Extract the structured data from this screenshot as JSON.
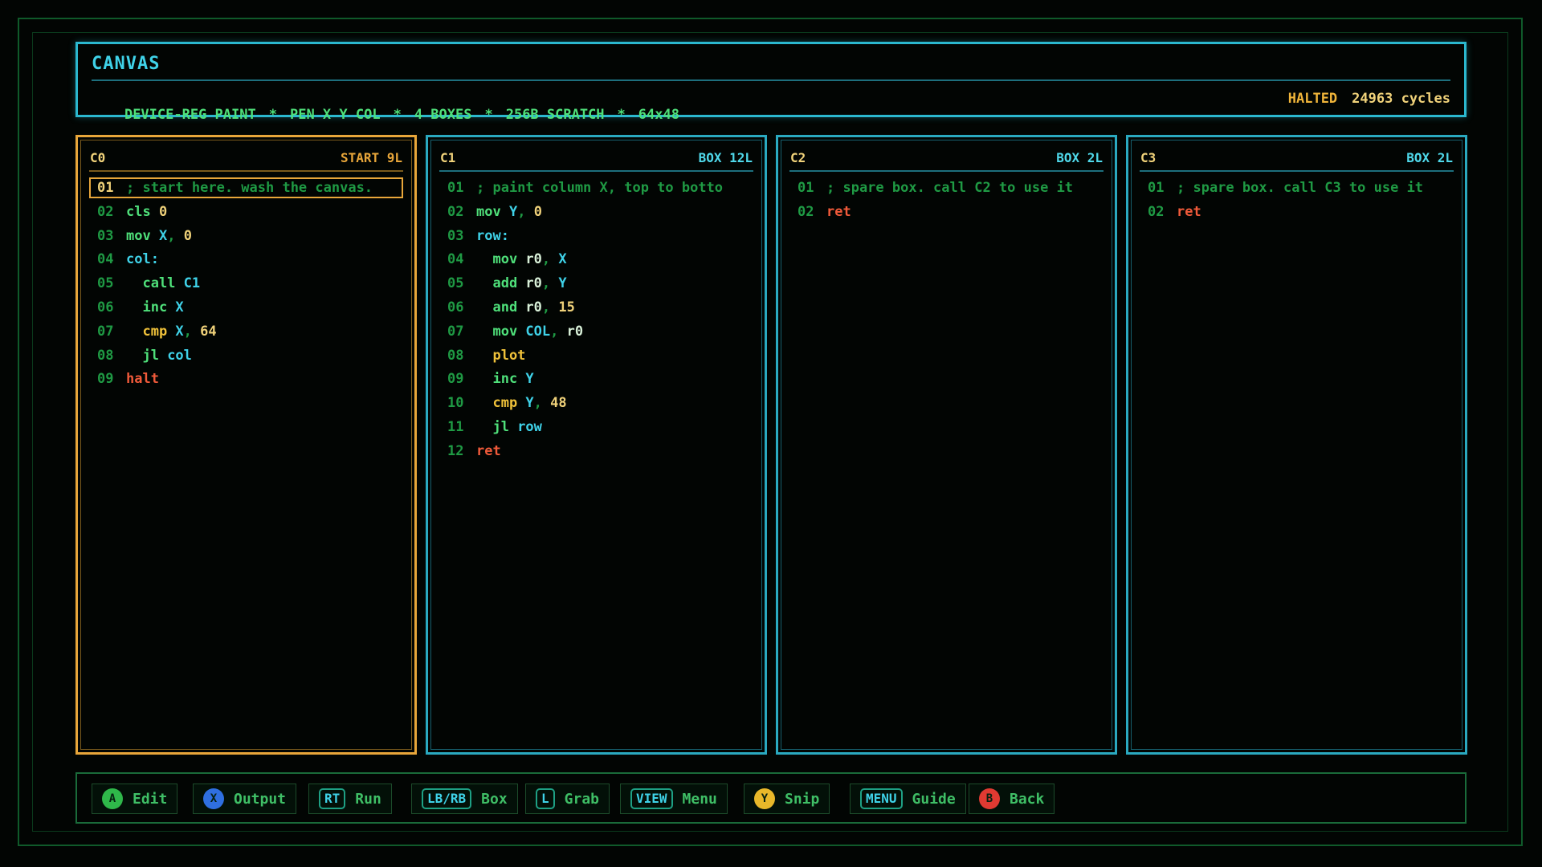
{
  "header": {
    "title": "CANVAS",
    "specs": [
      "DEVICE-REG PAINT",
      "PEN X Y COL",
      "4 BOXES",
      "256B SCRATCH",
      "64x48"
    ],
    "separator": "*",
    "status": "HALTED",
    "cycles": "24963 cycles"
  },
  "panels": [
    {
      "name": "C0",
      "meta": "START 9L",
      "lines": [
        {
          "n": "01",
          "parts": [
            {
              "t": "; start here. wash the canvas.",
              "c": "comment"
            }
          ]
        },
        {
          "n": "02",
          "parts": [
            {
              "t": "cls ",
              "c": "op-green"
            },
            {
              "t": "0",
              "c": "arg-yellow"
            }
          ]
        },
        {
          "n": "03",
          "parts": [
            {
              "t": "mov ",
              "c": "op-green"
            },
            {
              "t": "X",
              "c": "arg-cyan"
            },
            {
              "t": ", ",
              "c": "punct"
            },
            {
              "t": "0",
              "c": "arg-yellow"
            }
          ]
        },
        {
          "n": "04",
          "parts": [
            {
              "t": "col:",
              "c": "op-cyan"
            }
          ]
        },
        {
          "n": "05",
          "parts": [
            {
              "t": "  call ",
              "c": "op-green"
            },
            {
              "t": "C1",
              "c": "arg-cyan"
            }
          ]
        },
        {
          "n": "06",
          "parts": [
            {
              "t": "  inc ",
              "c": "op-green"
            },
            {
              "t": "X",
              "c": "arg-cyan"
            }
          ]
        },
        {
          "n": "07",
          "parts": [
            {
              "t": "  cmp ",
              "c": "op-yellow"
            },
            {
              "t": "X",
              "c": "arg-cyan"
            },
            {
              "t": ", ",
              "c": "punct"
            },
            {
              "t": "64",
              "c": "arg-yellow"
            }
          ]
        },
        {
          "n": "08",
          "parts": [
            {
              "t": "  jl ",
              "c": "op-green"
            },
            {
              "t": "col",
              "c": "arg-cyan"
            }
          ]
        },
        {
          "n": "09",
          "parts": [
            {
              "t": "halt",
              "c": "op-red"
            }
          ]
        }
      ]
    },
    {
      "name": "C1",
      "meta": "BOX 12L",
      "lines": [
        {
          "n": "01",
          "parts": [
            {
              "t": "; paint column X, top to botto",
              "c": "comment"
            }
          ]
        },
        {
          "n": "02",
          "parts": [
            {
              "t": "mov ",
              "c": "op-green"
            },
            {
              "t": "Y",
              "c": "arg-cyan"
            },
            {
              "t": ", ",
              "c": "punct"
            },
            {
              "t": "0",
              "c": "arg-yellow"
            }
          ]
        },
        {
          "n": "03",
          "parts": [
            {
              "t": "row:",
              "c": "op-cyan"
            }
          ]
        },
        {
          "n": "04",
          "parts": [
            {
              "t": "  mov ",
              "c": "op-green"
            },
            {
              "t": "r0",
              "c": "arg-white"
            },
            {
              "t": ", ",
              "c": "punct"
            },
            {
              "t": "X",
              "c": "arg-cyan"
            }
          ]
        },
        {
          "n": "05",
          "parts": [
            {
              "t": "  add ",
              "c": "op-green"
            },
            {
              "t": "r0",
              "c": "arg-white"
            },
            {
              "t": ", ",
              "c": "punct"
            },
            {
              "t": "Y",
              "c": "arg-cyan"
            }
          ]
        },
        {
          "n": "06",
          "parts": [
            {
              "t": "  and ",
              "c": "op-green"
            },
            {
              "t": "r0",
              "c": "arg-white"
            },
            {
              "t": ", ",
              "c": "punct"
            },
            {
              "t": "15",
              "c": "arg-yellow"
            }
          ]
        },
        {
          "n": "07",
          "parts": [
            {
              "t": "  mov ",
              "c": "op-green"
            },
            {
              "t": "COL",
              "c": "arg-cyan"
            },
            {
              "t": ", ",
              "c": "punct"
            },
            {
              "t": "r0",
              "c": "arg-white"
            }
          ]
        },
        {
          "n": "08",
          "parts": [
            {
              "t": "  plot",
              "c": "op-yellow"
            }
          ]
        },
        {
          "n": "09",
          "parts": [
            {
              "t": "  inc ",
              "c": "op-green"
            },
            {
              "t": "Y",
              "c": "arg-cyan"
            }
          ]
        },
        {
          "n": "10",
          "parts": [
            {
              "t": "  cmp ",
              "c": "op-yellow"
            },
            {
              "t": "Y",
              "c": "arg-cyan"
            },
            {
              "t": ", ",
              "c": "punct"
            },
            {
              "t": "48",
              "c": "arg-yellow"
            }
          ]
        },
        {
          "n": "11",
          "parts": [
            {
              "t": "  jl ",
              "c": "op-green"
            },
            {
              "t": "row",
              "c": "arg-cyan"
            }
          ]
        },
        {
          "n": "12",
          "parts": [
            {
              "t": "ret",
              "c": "op-red"
            }
          ]
        }
      ]
    },
    {
      "name": "C2",
      "meta": "BOX 2L",
      "lines": [
        {
          "n": "01",
          "parts": [
            {
              "t": "; spare box. call C2 to use it",
              "c": "comment"
            }
          ]
        },
        {
          "n": "02",
          "parts": [
            {
              "t": "ret",
              "c": "op-red"
            }
          ]
        }
      ]
    },
    {
      "name": "C3",
      "meta": "BOX 2L",
      "lines": [
        {
          "n": "01",
          "parts": [
            {
              "t": "; spare box. call C3 to use it",
              "c": "comment"
            }
          ]
        },
        {
          "n": "02",
          "parts": [
            {
              "t": "ret",
              "c": "op-red"
            }
          ]
        }
      ]
    }
  ],
  "footer": {
    "buttons": [
      {
        "key": "A",
        "type": "circle",
        "color": "#2fb84a",
        "label": "Edit"
      },
      {
        "key": "X",
        "type": "circle",
        "color": "#2f6fe0",
        "label": "Output"
      },
      {
        "key": "RT",
        "type": "tag",
        "label": "Run"
      },
      {
        "key": "LB/RB",
        "type": "tag",
        "label": "Box"
      },
      {
        "key": "L",
        "type": "tag",
        "label": "Grab"
      },
      {
        "key": "VIEW",
        "type": "tag",
        "label": "Menu"
      },
      {
        "key": "Y",
        "type": "circle",
        "color": "#e8b82a",
        "label": "Snip"
      },
      {
        "key": "MENU",
        "type": "tag",
        "label": "Guide"
      },
      {
        "key": "B",
        "type": "circle",
        "color": "#e03a32",
        "label": "Back"
      }
    ]
  },
  "colors": {
    "accent_cyan": "#2bb8cf",
    "accent_amber": "#e8a63a",
    "code_green": "#4fe07a",
    "comment_green": "#1f9a44",
    "keyword_red": "#f05a3a"
  }
}
